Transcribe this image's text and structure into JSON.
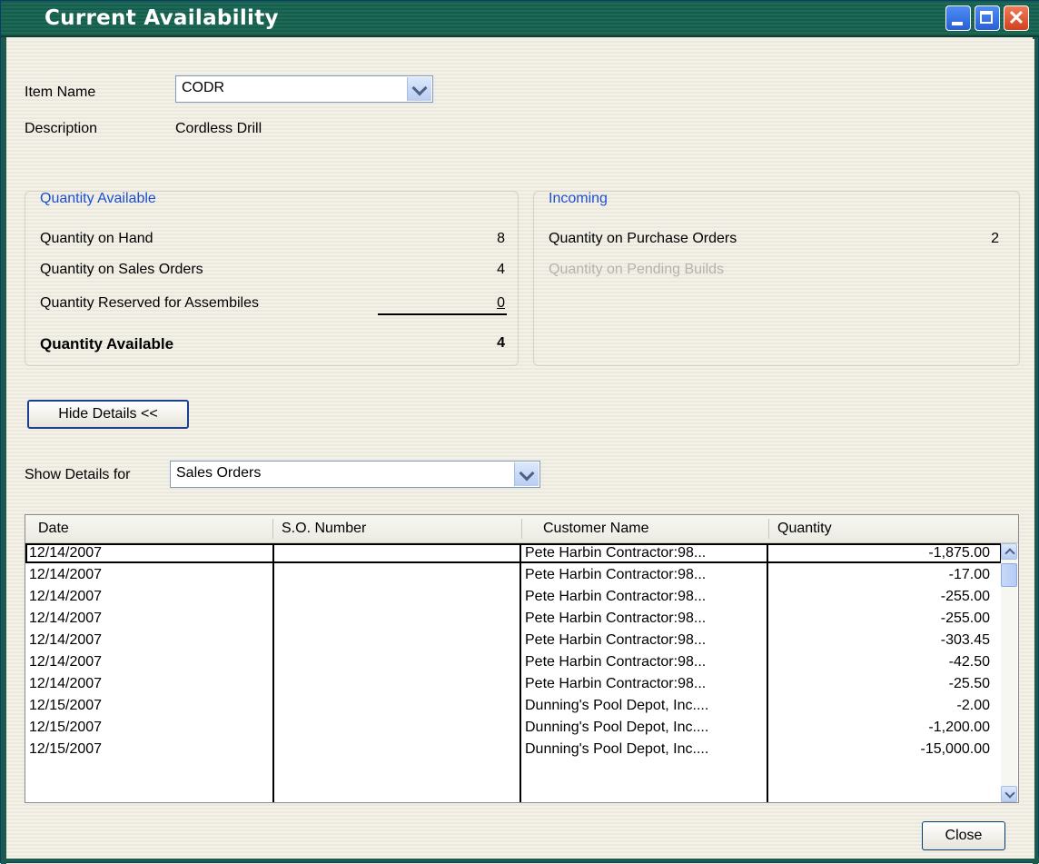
{
  "window": {
    "title": "Current Availability"
  },
  "item": {
    "name_label": "Item Name",
    "name_value": "CODR",
    "description_label": "Description",
    "description_value": "Cordless Drill"
  },
  "quantity_available": {
    "title": "Quantity Available",
    "on_hand_label": "Quantity on Hand",
    "on_hand_value": "8",
    "on_sales_orders_label": "Quantity on Sales Orders",
    "on_sales_orders_value": "4",
    "reserved_label": "Quantity Reserved for Assembiles",
    "reserved_value": "0",
    "available_label": "Quantity Available",
    "available_value": "4"
  },
  "incoming": {
    "title": "Incoming",
    "purchase_orders_label": "Quantity on Purchase Orders",
    "purchase_orders_value": "2",
    "pending_builds_label": "Quantity on Pending Builds"
  },
  "details_button_label": "Hide Details <<",
  "show_details": {
    "label": "Show Details for",
    "value": "Sales Orders"
  },
  "table": {
    "headers": [
      "Date",
      "S.O. Number",
      "Customer Name",
      "Quantity"
    ],
    "rows": [
      {
        "date": "12/14/2007",
        "so": "",
        "customer": "Pete Harbin Contractor:98...",
        "qty": "-1,875.00"
      },
      {
        "date": "12/14/2007",
        "so": "",
        "customer": "Pete Harbin Contractor:98...",
        "qty": "-17.00"
      },
      {
        "date": "12/14/2007",
        "so": "",
        "customer": "Pete Harbin Contractor:98...",
        "qty": "-255.00"
      },
      {
        "date": "12/14/2007",
        "so": "",
        "customer": "Pete Harbin Contractor:98...",
        "qty": "-255.00"
      },
      {
        "date": "12/14/2007",
        "so": "",
        "customer": "Pete Harbin Contractor:98...",
        "qty": "-303.45"
      },
      {
        "date": "12/14/2007",
        "so": "",
        "customer": "Pete Harbin Contractor:98...",
        "qty": "-42.50"
      },
      {
        "date": "12/14/2007",
        "so": "",
        "customer": "Pete Harbin Contractor:98...",
        "qty": "-25.50"
      },
      {
        "date": "12/15/2007",
        "so": "",
        "customer": "Dunning's Pool Depot, Inc....",
        "qty": "-2.00"
      },
      {
        "date": "12/15/2007",
        "so": "",
        "customer": "Dunning's Pool Depot, Inc....",
        "qty": "-1,200.00"
      },
      {
        "date": "12/15/2007",
        "so": "",
        "customer": "Dunning's Pool Depot, Inc....",
        "qty": "-15,000.00"
      }
    ]
  },
  "close_button_label": "Close"
}
